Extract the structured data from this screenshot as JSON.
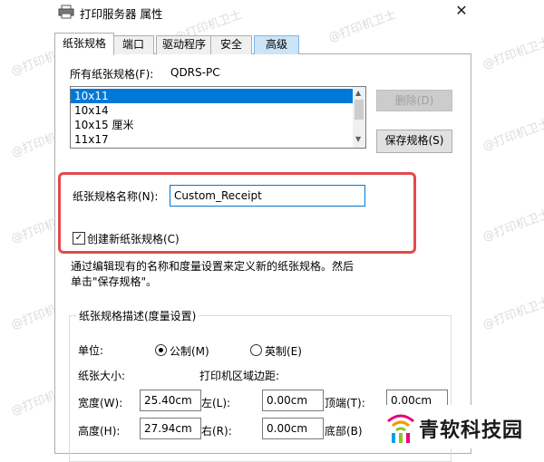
{
  "window": {
    "title": "打印服务器 属性",
    "close_glyph": "✕",
    "icon": "printer-icon"
  },
  "tabs": [
    {
      "label": "纸张规格",
      "active": true
    },
    {
      "label": "端口",
      "active": false
    },
    {
      "label": "驱动程序",
      "active": false
    },
    {
      "label": "安全",
      "active": false
    },
    {
      "label": "高级",
      "active": false,
      "highlighted": true
    }
  ],
  "forms": {
    "all_forms_label": "所有纸张规格(F):",
    "server_name": "QDRS-PC",
    "list": [
      "10x11",
      "10x14",
      "10x15 厘米",
      "11x17"
    ],
    "selected_index": 0,
    "delete_button": "删除(D)",
    "save_button": "保存规格(S)"
  },
  "form_name": {
    "label": "纸张规格名称(N):",
    "value": "Custom_Receipt"
  },
  "create_new": {
    "label": "创建新纸张规格(C)",
    "checked": true,
    "check_glyph": "✓"
  },
  "description": "通过编辑现有的名称和度量设置来定义新的纸张规格。然后单击\"保存规格\"。",
  "measurements": {
    "group_title": "纸张规格描述(度量设置)",
    "unit_label": "单位:",
    "metric": "公制(M)",
    "english": "英制(E)",
    "selected_unit": "metric",
    "paper_size_label": "纸张大小:",
    "margins_label": "打印机区域边距:",
    "width_label": "宽度(W):",
    "width_value": "25.40cm",
    "height_label": "高度(H):",
    "height_value": "27.94cm",
    "left_label": "左(L):",
    "left_value": "0.00cm",
    "right_label": "右(R):",
    "right_value": "0.00cm",
    "top_label": "顶端(T):",
    "top_value": "0.00cm",
    "bottom_label": "底部(B)"
  },
  "watermark": "@打印机卫士",
  "logo": {
    "text": "青软科技园",
    "icon": "wifi-signal-logo-icon"
  },
  "colors": {
    "selection": "#0078d7",
    "highlight_box": "#e24a4a",
    "tab_highlight": "#cce4f7"
  }
}
